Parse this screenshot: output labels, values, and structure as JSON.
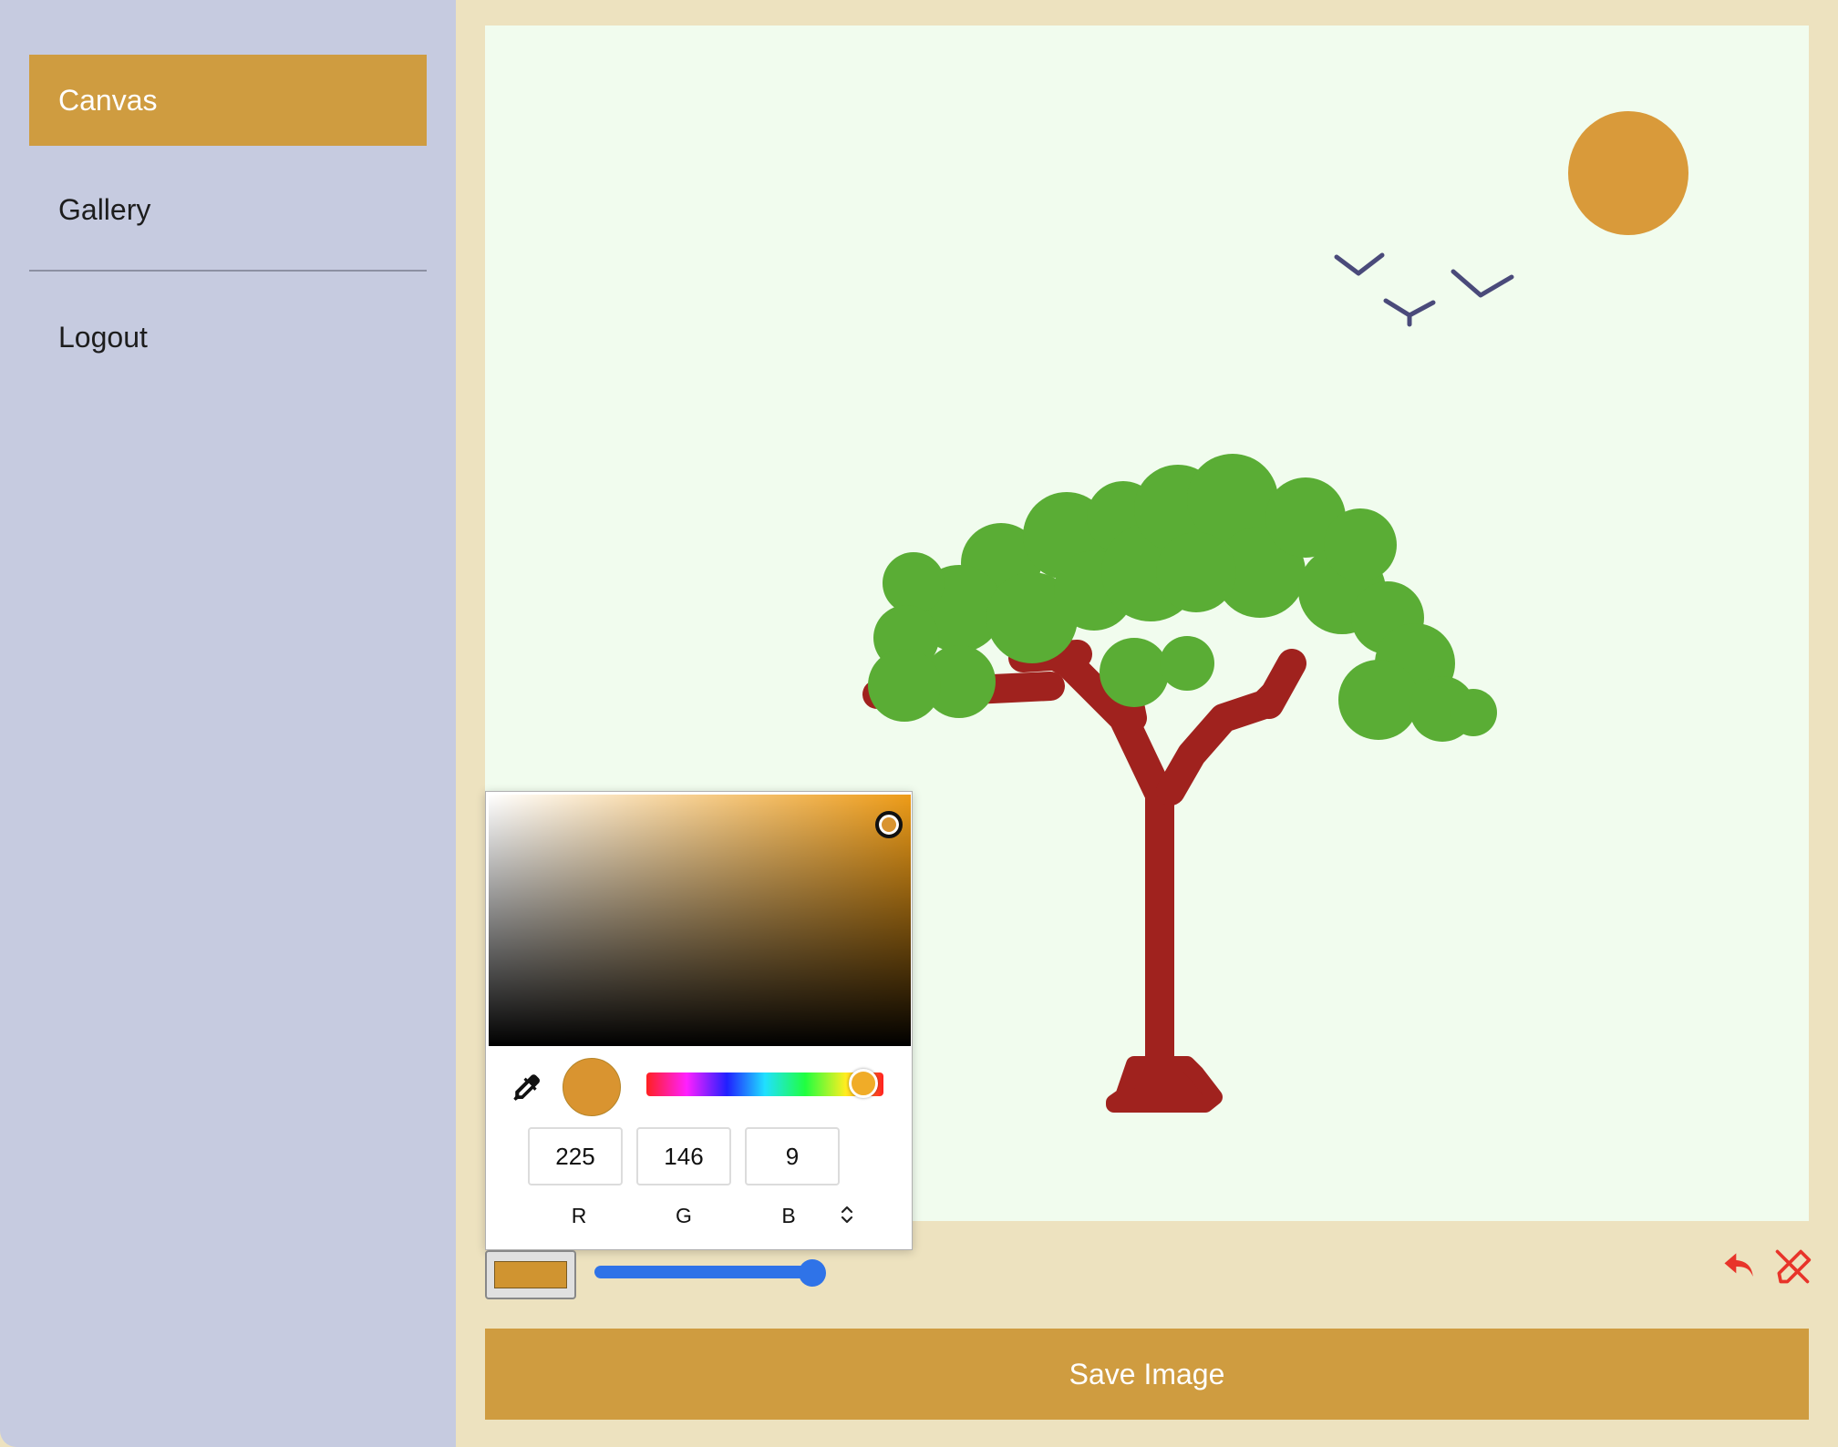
{
  "sidebar": {
    "items": [
      {
        "label": "Canvas",
        "active": true
      },
      {
        "label": "Gallery",
        "active": false
      },
      {
        "label": "Logout",
        "active": false
      }
    ]
  },
  "color_picker": {
    "r": "225",
    "g": "146",
    "b": "9",
    "r_label": "R",
    "g_label": "G",
    "b_label": "B",
    "selected_color": "#e19209",
    "hue_fraction": 0.9
  },
  "toolbar": {
    "brush_size_fraction": 1.0,
    "icons": [
      "eyedropper-icon",
      "undo-icon",
      "clear-canvas-icon"
    ]
  },
  "save_button": {
    "label": "Save Image"
  },
  "colors": {
    "accent": "#cf9c40",
    "sidebar_bg": "#c6cbe0",
    "page_bg": "#ede2bf",
    "canvas_bg": "#f1fcee",
    "icon_red": "#e8342a",
    "slider_blue": "#2f73e8"
  },
  "drawing": {
    "elements": [
      "sun",
      "birds",
      "tree"
    ],
    "colors": {
      "sun": "#d99a3a",
      "birds": "#4a4a7a",
      "leaves": "#5aad35",
      "trunk": "#a0221e"
    }
  }
}
